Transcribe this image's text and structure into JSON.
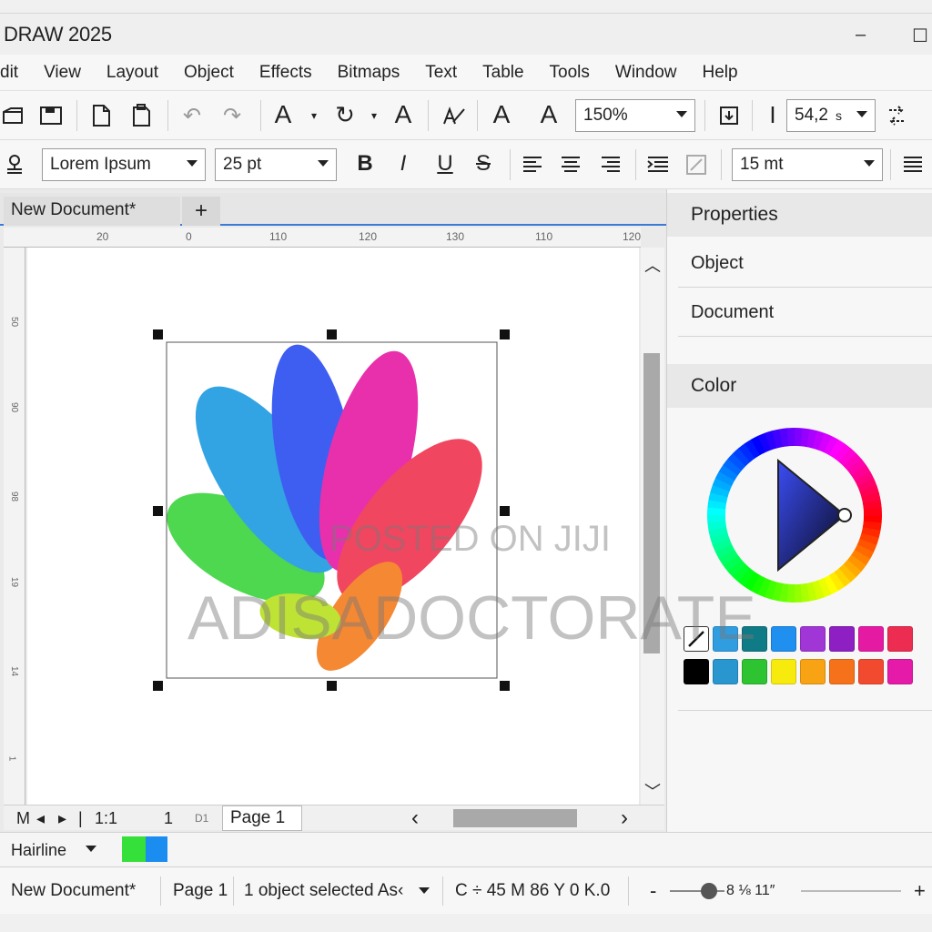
{
  "window": {
    "title": "DRAW 2025",
    "minimize": "–",
    "maximize": "☐"
  },
  "menu": [
    "dit",
    "View",
    "Layout",
    "Object",
    "Effects",
    "Bitmaps",
    "Text",
    "Table",
    "Tools",
    "Window",
    "Help"
  ],
  "toolbar1": {
    "zoom": "150%",
    "size_value": "54,2",
    "size_unit": "s"
  },
  "toolbar2": {
    "font": "Lorem Ipsum",
    "font_size": "25 pt",
    "spacing": "15 mt"
  },
  "tabs": {
    "doc": "New Document*",
    "add": "+"
  },
  "ruler_h": [
    "20",
    "0",
    "110",
    "120",
    "130",
    "110",
    "120"
  ],
  "ruler_v": [
    "50",
    "90",
    "98",
    "19",
    "14",
    "1"
  ],
  "nav": {
    "first": "M",
    "prev": "◂",
    "next": "▸",
    "last": "|",
    "ratio": "1:1",
    "page_num": "1",
    "d": "D1",
    "page": "Page 1",
    "left": "‹",
    "right": "›"
  },
  "outline": {
    "label": "Hairline",
    "fill_color": "#35e03a",
    "stroke_color": "#1b8df0"
  },
  "status": {
    "doc": "New Document*",
    "page": "Page 1",
    "selection": "1 object selected As‹",
    "color": "C ÷ 45 M 86 Y 0 K.0",
    "minus": "-",
    "zoom": "8 ⅛ 11″",
    "plus": "+"
  },
  "panel": {
    "properties": "Properties",
    "items": [
      "Object",
      "Document"
    ],
    "color": "Color",
    "swatches_row1": [
      "#2f9de0",
      "#0e7b86",
      "#1f8ff0",
      "#a036d6",
      "#8e1fc2",
      "#e51aa3",
      "#ec2c50"
    ],
    "swatches_row2": [
      "#000000",
      "#2a96cf",
      "#2ec431",
      "#f7ea0d",
      "#f7a313",
      "#f5721a",
      "#f24a2e",
      "#e51aa8"
    ]
  },
  "watermarks": {
    "line1": "POSTED ON JIJI",
    "line2": "ADISADOCTORATE"
  }
}
